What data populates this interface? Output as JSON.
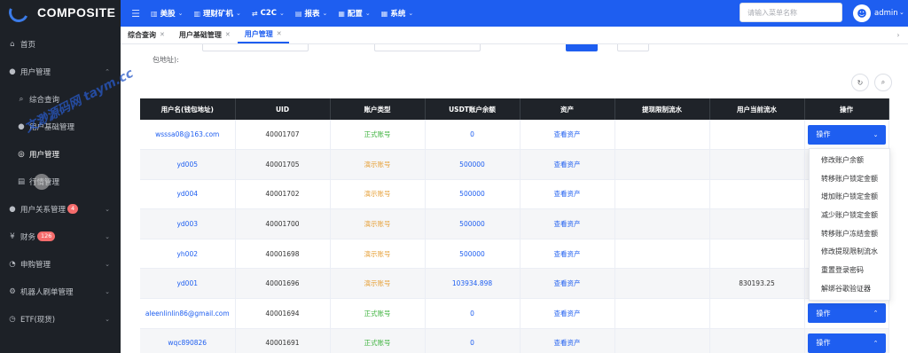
{
  "brand": {
    "name": "COMPOSITE"
  },
  "sidebar": {
    "items": [
      {
        "label": "首页",
        "icon": "home-icon"
      },
      {
        "label": "用户管理",
        "icon": "user-icon",
        "expanded": true
      },
      {
        "label": "综合查询",
        "icon": "search-icon"
      },
      {
        "label": "用户基础管理",
        "icon": "user-icon"
      },
      {
        "label": "用户管理",
        "icon": "user-circle-icon"
      },
      {
        "label": "行情管理",
        "icon": "list-icon"
      },
      {
        "label": "用户关系管理",
        "icon": "user-icon",
        "badge": "4"
      },
      {
        "label": "财务",
        "icon": "finance-icon",
        "badge": "126"
      },
      {
        "label": "申购管理",
        "icon": "subscribe-icon"
      },
      {
        "label": "机器人刷单管理",
        "icon": "robot-icon"
      },
      {
        "label": "ETF(现货)",
        "icon": "etf-icon"
      }
    ]
  },
  "topnav": {
    "items": [
      {
        "label": "美股",
        "icon": "chart-icon"
      },
      {
        "label": "理财矿机",
        "icon": "chart-icon"
      },
      {
        "label": "C2C",
        "icon": "exchange-icon"
      },
      {
        "label": "报表",
        "icon": "report-icon"
      },
      {
        "label": "配置",
        "icon": "config-icon"
      },
      {
        "label": "系统",
        "icon": "system-icon"
      }
    ],
    "search_placeholder": "请输入菜单名称",
    "username": "admin"
  },
  "tabs": [
    {
      "label": "综合查询",
      "active": false
    },
    {
      "label": "用户基础管理",
      "active": false
    },
    {
      "label": "用户管理",
      "active": true
    }
  ],
  "filter": {
    "fragment_label": "包地址):"
  },
  "table": {
    "headers": [
      "用户名(钱包地址)",
      "UID",
      "账户类型",
      "USDT账户余额",
      "资产",
      "提现限制流水",
      "用户当前流水",
      "操作"
    ],
    "rows": [
      {
        "user": "wsssa08@163.com",
        "uid": "40001707",
        "type": "正式账号",
        "type_kind": "real",
        "balance": "0",
        "asset": "查看资产",
        "limit": "",
        "flow": "",
        "op": "操作"
      },
      {
        "user": "yd005",
        "uid": "40001705",
        "type": "演示账号",
        "type_kind": "demo",
        "balance": "500000",
        "asset": "查看资产",
        "limit": "",
        "flow": "",
        "op": ""
      },
      {
        "user": "yd004",
        "uid": "40001702",
        "type": "演示账号",
        "type_kind": "demo",
        "balance": "500000",
        "asset": "查看资产",
        "limit": "",
        "flow": "",
        "op": ""
      },
      {
        "user": "yd003",
        "uid": "40001700",
        "type": "演示账号",
        "type_kind": "demo",
        "balance": "500000",
        "asset": "查看资产",
        "limit": "",
        "flow": "",
        "op": ""
      },
      {
        "user": "yh002",
        "uid": "40001698",
        "type": "演示账号",
        "type_kind": "demo",
        "balance": "500000",
        "asset": "查看资产",
        "limit": "",
        "flow": "",
        "op": ""
      },
      {
        "user": "yd001",
        "uid": "40001696",
        "type": "演示账号",
        "type_kind": "demo",
        "balance": "103934.898",
        "asset": "查看资产",
        "limit": "",
        "flow": "830193.25",
        "op": ""
      },
      {
        "user": "aleenlinlin86@gmail.com",
        "uid": "40001694",
        "type": "正式账号",
        "type_kind": "real",
        "balance": "0",
        "asset": "查看资产",
        "limit": "",
        "flow": "",
        "op": "操作"
      },
      {
        "user": "wqc890826",
        "uid": "40001691",
        "type": "正式账号",
        "type_kind": "real",
        "balance": "0",
        "asset": "查看资产",
        "limit": "",
        "flow": "",
        "op": "操作"
      }
    ]
  },
  "dropdown": {
    "items": [
      "修改账户余额",
      "转移账户锁定金额",
      "增加账户锁定金额",
      "减少账户锁定金额",
      "转移账户冻结金额",
      "修改提现限制流水",
      "重置登录密码",
      "解绑谷歌验证器"
    ]
  },
  "watermark": "文渺源码网 taym.cc",
  "colors": {
    "primary": "#1e5ef0",
    "sidebar": "#1d2127",
    "real": "#3fb33f",
    "demo": "#e6a23c"
  }
}
